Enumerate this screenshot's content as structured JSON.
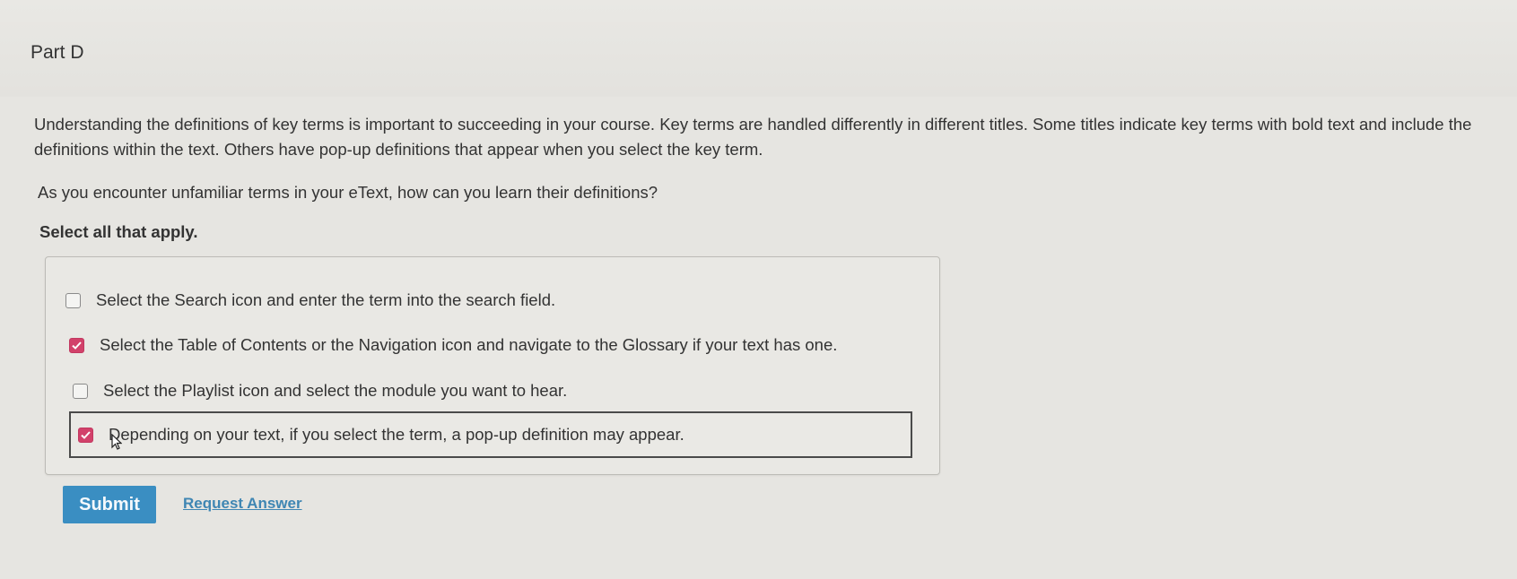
{
  "part": {
    "title": "Part D"
  },
  "intro_text": "Understanding the definitions of key terms is important to succeeding in your course. Key terms are handled differently in different titles. Some titles indicate key terms with bold text and include the definitions within the text. Others have pop-up definitions that appear when you select the key term.",
  "question_text": "As you encounter unfamiliar terms in your eText, how can you learn their definitions?",
  "instruction_text": "Select all that apply.",
  "options": [
    {
      "label": "Select the Search icon and enter the term into the search field.",
      "checked": false
    },
    {
      "label": "Select the Table of Contents or the Navigation icon and navigate to the Glossary if your text has one.",
      "checked": true
    },
    {
      "label": "Select the Playlist icon and select the module you want to hear.",
      "checked": false
    },
    {
      "label": "Depending on your text, if you select the term, a pop-up definition may appear.",
      "checked": true
    }
  ],
  "actions": {
    "submit_label": "Submit",
    "request_answer_label": "Request Answer"
  },
  "colors": {
    "accent": "#3a8ec2",
    "checked": "#d2416a",
    "link": "#3f86b3"
  },
  "icons": {
    "checkmark": "checkmark-icon",
    "pointer": "mouse-pointer-icon"
  }
}
